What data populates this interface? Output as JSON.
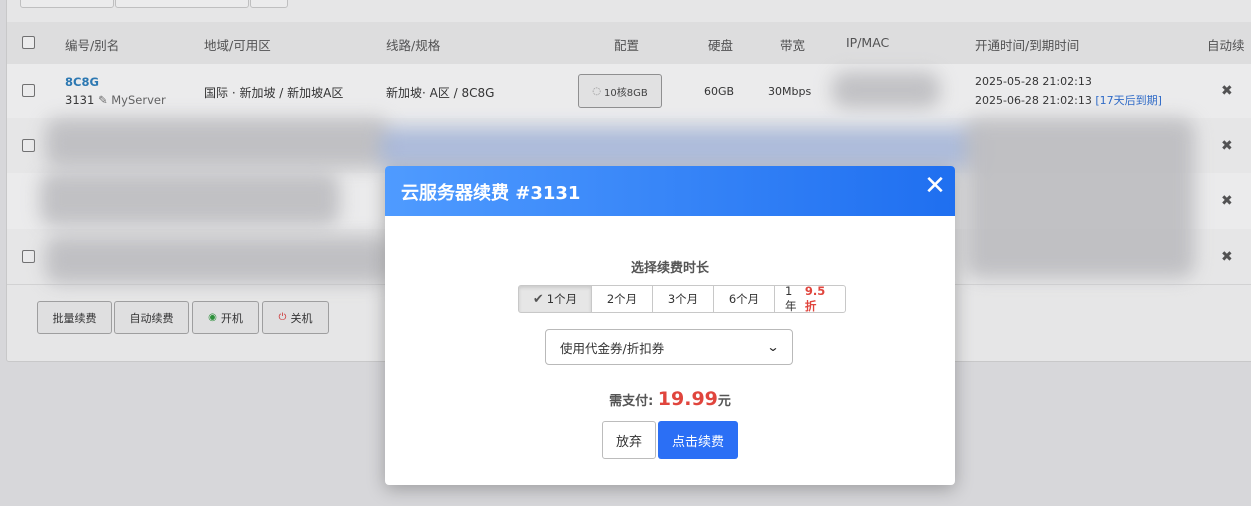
{
  "table": {
    "headers": {
      "id_alias": "编号/别名",
      "region": "地域/可用区",
      "line": "线路/规格",
      "config": "配置",
      "disk": "硬盘",
      "bandwidth": "带宽",
      "ipmac": "IP/MAC",
      "time": "开通时间/到期时间",
      "auto": "自动续"
    },
    "row1": {
      "alias": "8C8G",
      "id": "3131",
      "name": "MyServer",
      "region": "国际 · 新加坡 / 新加坡A区",
      "line": "新加坡· A区 / 8C8G",
      "config": "10核8GB",
      "disk": "60GB",
      "bandwidth": "30Mbps",
      "open_time": "2025-05-28 21:02:13",
      "expire_time": "2025-06-28 21:02:13",
      "expire_note": "[17天后到期]",
      "auto": "✖"
    },
    "row_auto_mark": "✖"
  },
  "actions": {
    "batch_renew": "批量续费",
    "auto_renew": "自动续费",
    "power_on": "开机",
    "power_off": "关机"
  },
  "modal": {
    "title": "云服务器续费 #3131",
    "close": "✕",
    "duration_label": "选择续费时长",
    "durations": [
      "1个月",
      "2个月",
      "3个月",
      "6个月",
      "1年"
    ],
    "year_discount": "9.5折",
    "selected_duration": "1个月",
    "coupon_select": "使用代金券/折扣券",
    "pay_label": "需支付:",
    "price": "19.99",
    "currency": "元",
    "cancel_button": "放弃",
    "confirm_button": "点击续费"
  }
}
